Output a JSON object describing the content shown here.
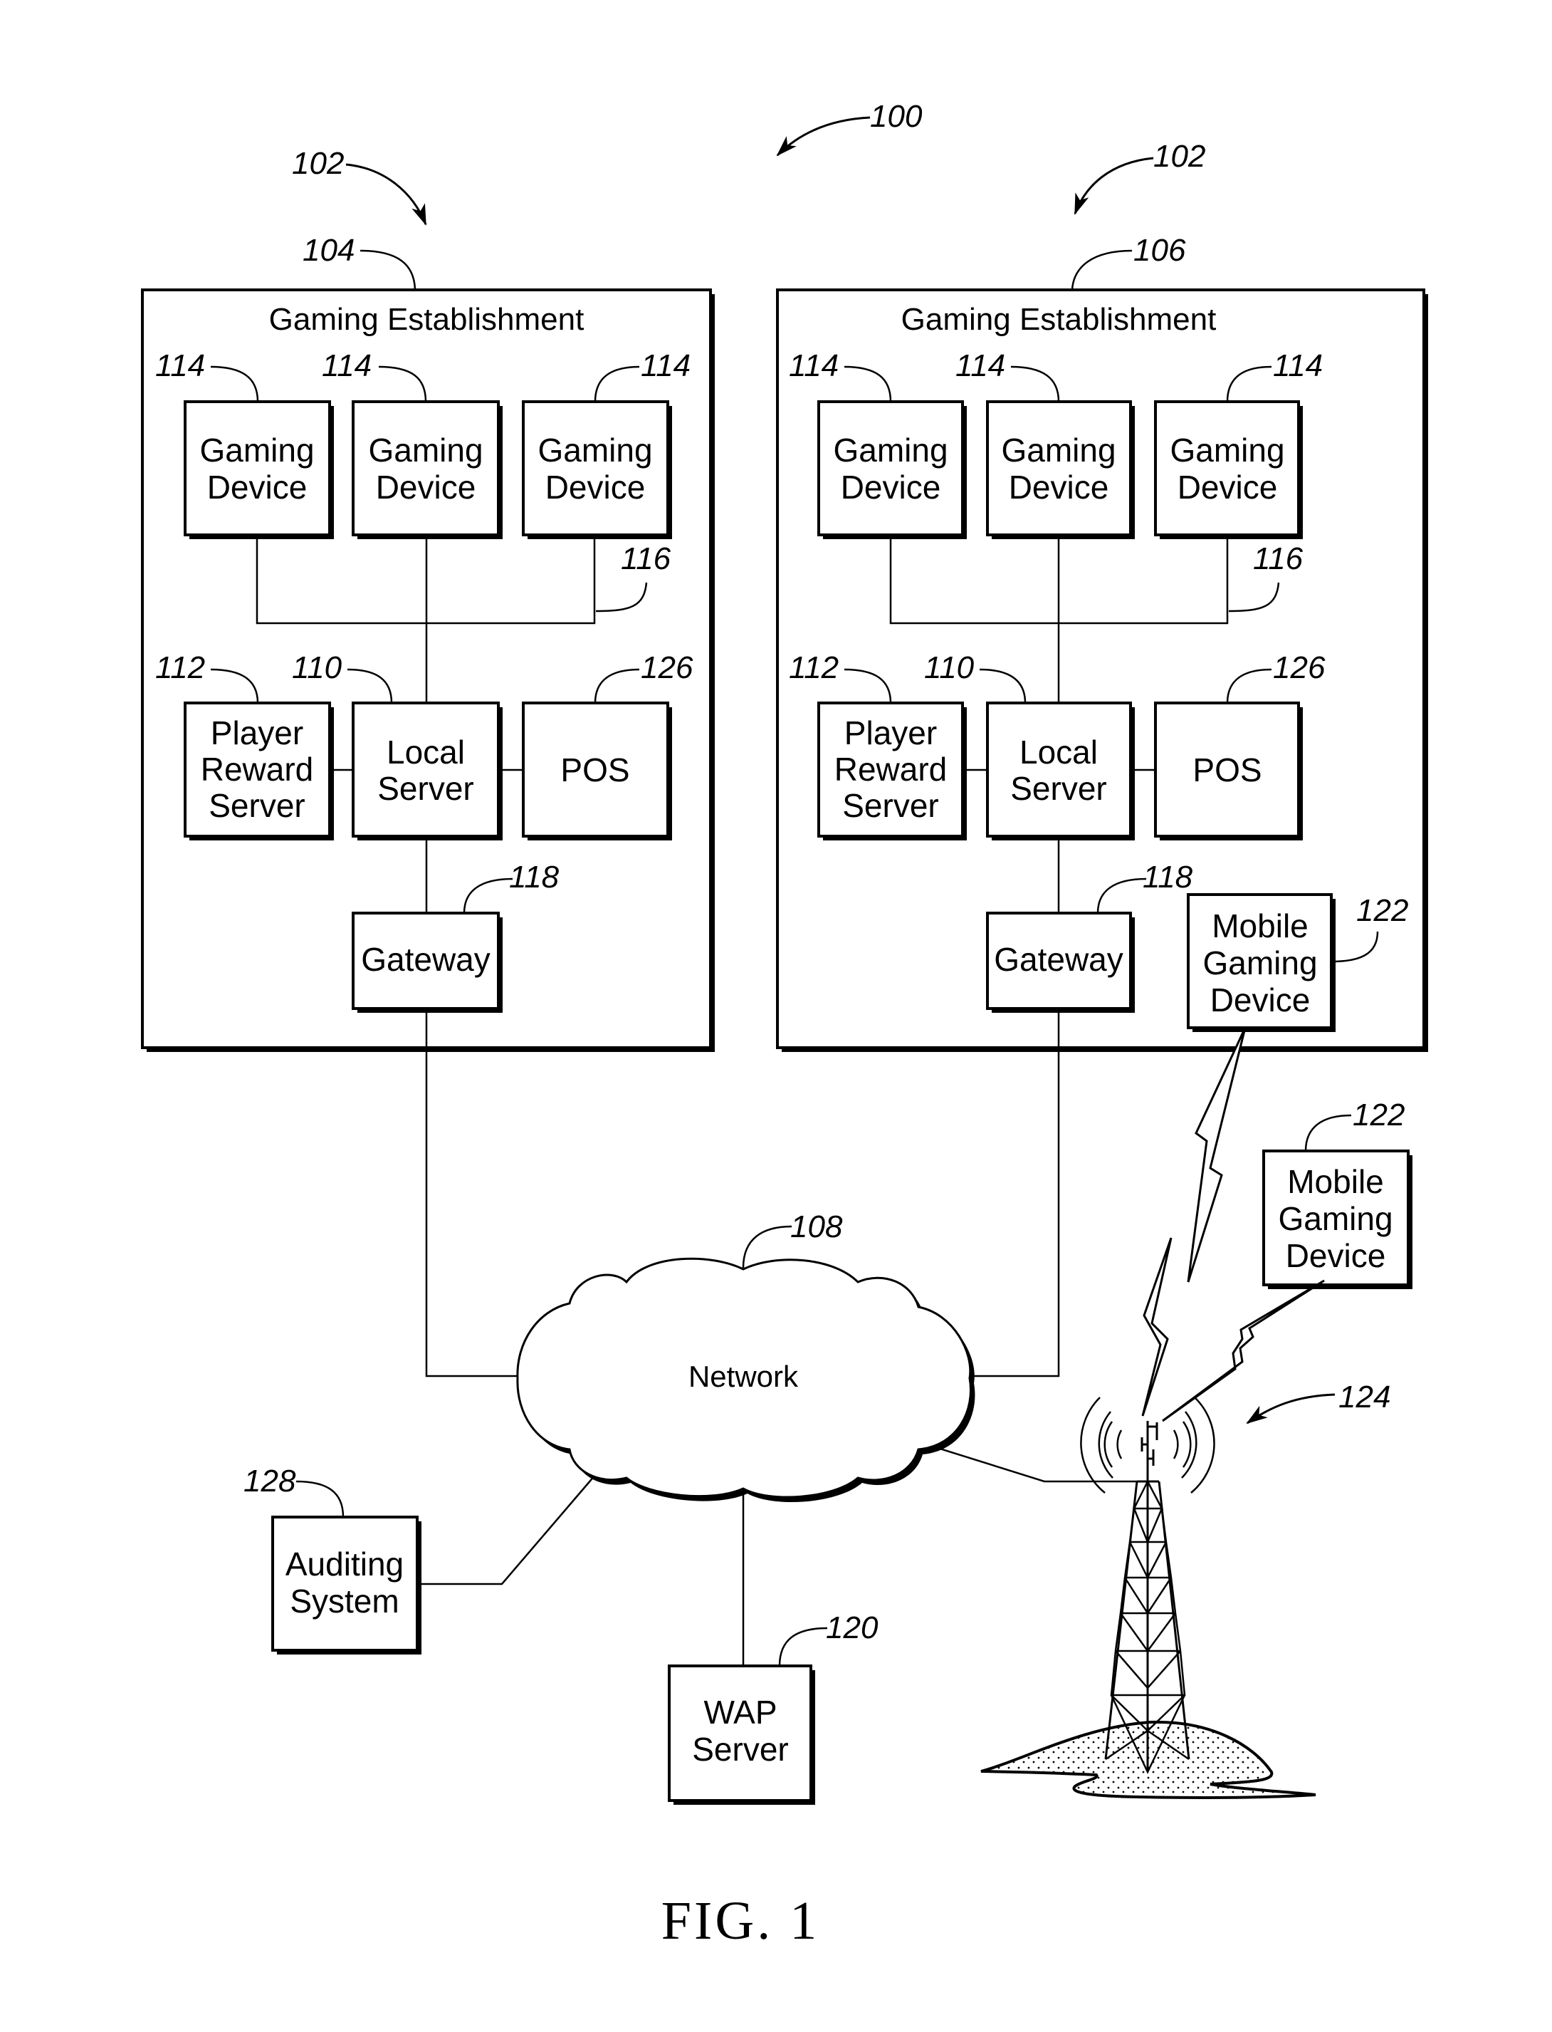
{
  "figure": {
    "caption": "FIG. 1",
    "system_ref": "100"
  },
  "establishments": [
    {
      "ref": "104",
      "group_ref": "102",
      "title": "Gaming Establishment",
      "gaming_devices": [
        {
          "ref": "114",
          "lines": [
            "Gaming",
            "Device"
          ]
        },
        {
          "ref": "114",
          "lines": [
            "Gaming",
            "Device"
          ]
        },
        {
          "ref": "114",
          "lines": [
            "Gaming",
            "Device"
          ]
        }
      ],
      "bus_ref": "116",
      "player_reward_server": {
        "ref": "112",
        "lines": [
          "Player",
          "Reward",
          "Server"
        ]
      },
      "local_server": {
        "ref": "110",
        "lines": [
          "Local",
          "Server"
        ]
      },
      "pos": {
        "ref": "126",
        "lines": [
          "POS"
        ]
      },
      "gateway": {
        "ref": "118",
        "lines": [
          "Gateway"
        ]
      }
    },
    {
      "ref": "106",
      "group_ref": "102",
      "title": "Gaming Establishment",
      "gaming_devices": [
        {
          "ref": "114",
          "lines": [
            "Gaming",
            "Device"
          ]
        },
        {
          "ref": "114",
          "lines": [
            "Gaming",
            "Device"
          ]
        },
        {
          "ref": "114",
          "lines": [
            "Gaming",
            "Device"
          ]
        }
      ],
      "bus_ref": "116",
      "player_reward_server": {
        "ref": "112",
        "lines": [
          "Player",
          "Reward",
          "Server"
        ]
      },
      "local_server": {
        "ref": "110",
        "lines": [
          "Local",
          "Server"
        ]
      },
      "pos": {
        "ref": "126",
        "lines": [
          "POS"
        ]
      },
      "gateway": {
        "ref": "118",
        "lines": [
          "Gateway"
        ]
      },
      "mobile_gaming_device": {
        "ref": "122",
        "lines": [
          "Mobile",
          "Gaming",
          "Device"
        ]
      }
    }
  ],
  "network": {
    "ref": "108",
    "label": "Network"
  },
  "external_mobile_gaming_device": {
    "ref": "122",
    "lines": [
      "Mobile",
      "Gaming",
      "Device"
    ]
  },
  "wap_server": {
    "ref": "120",
    "lines": [
      "WAP",
      "Server"
    ]
  },
  "auditing_system": {
    "ref": "128",
    "lines": [
      "Auditing",
      "System"
    ]
  },
  "cell_tower": {
    "ref": "124",
    "icon": "cell-tower-icon"
  }
}
